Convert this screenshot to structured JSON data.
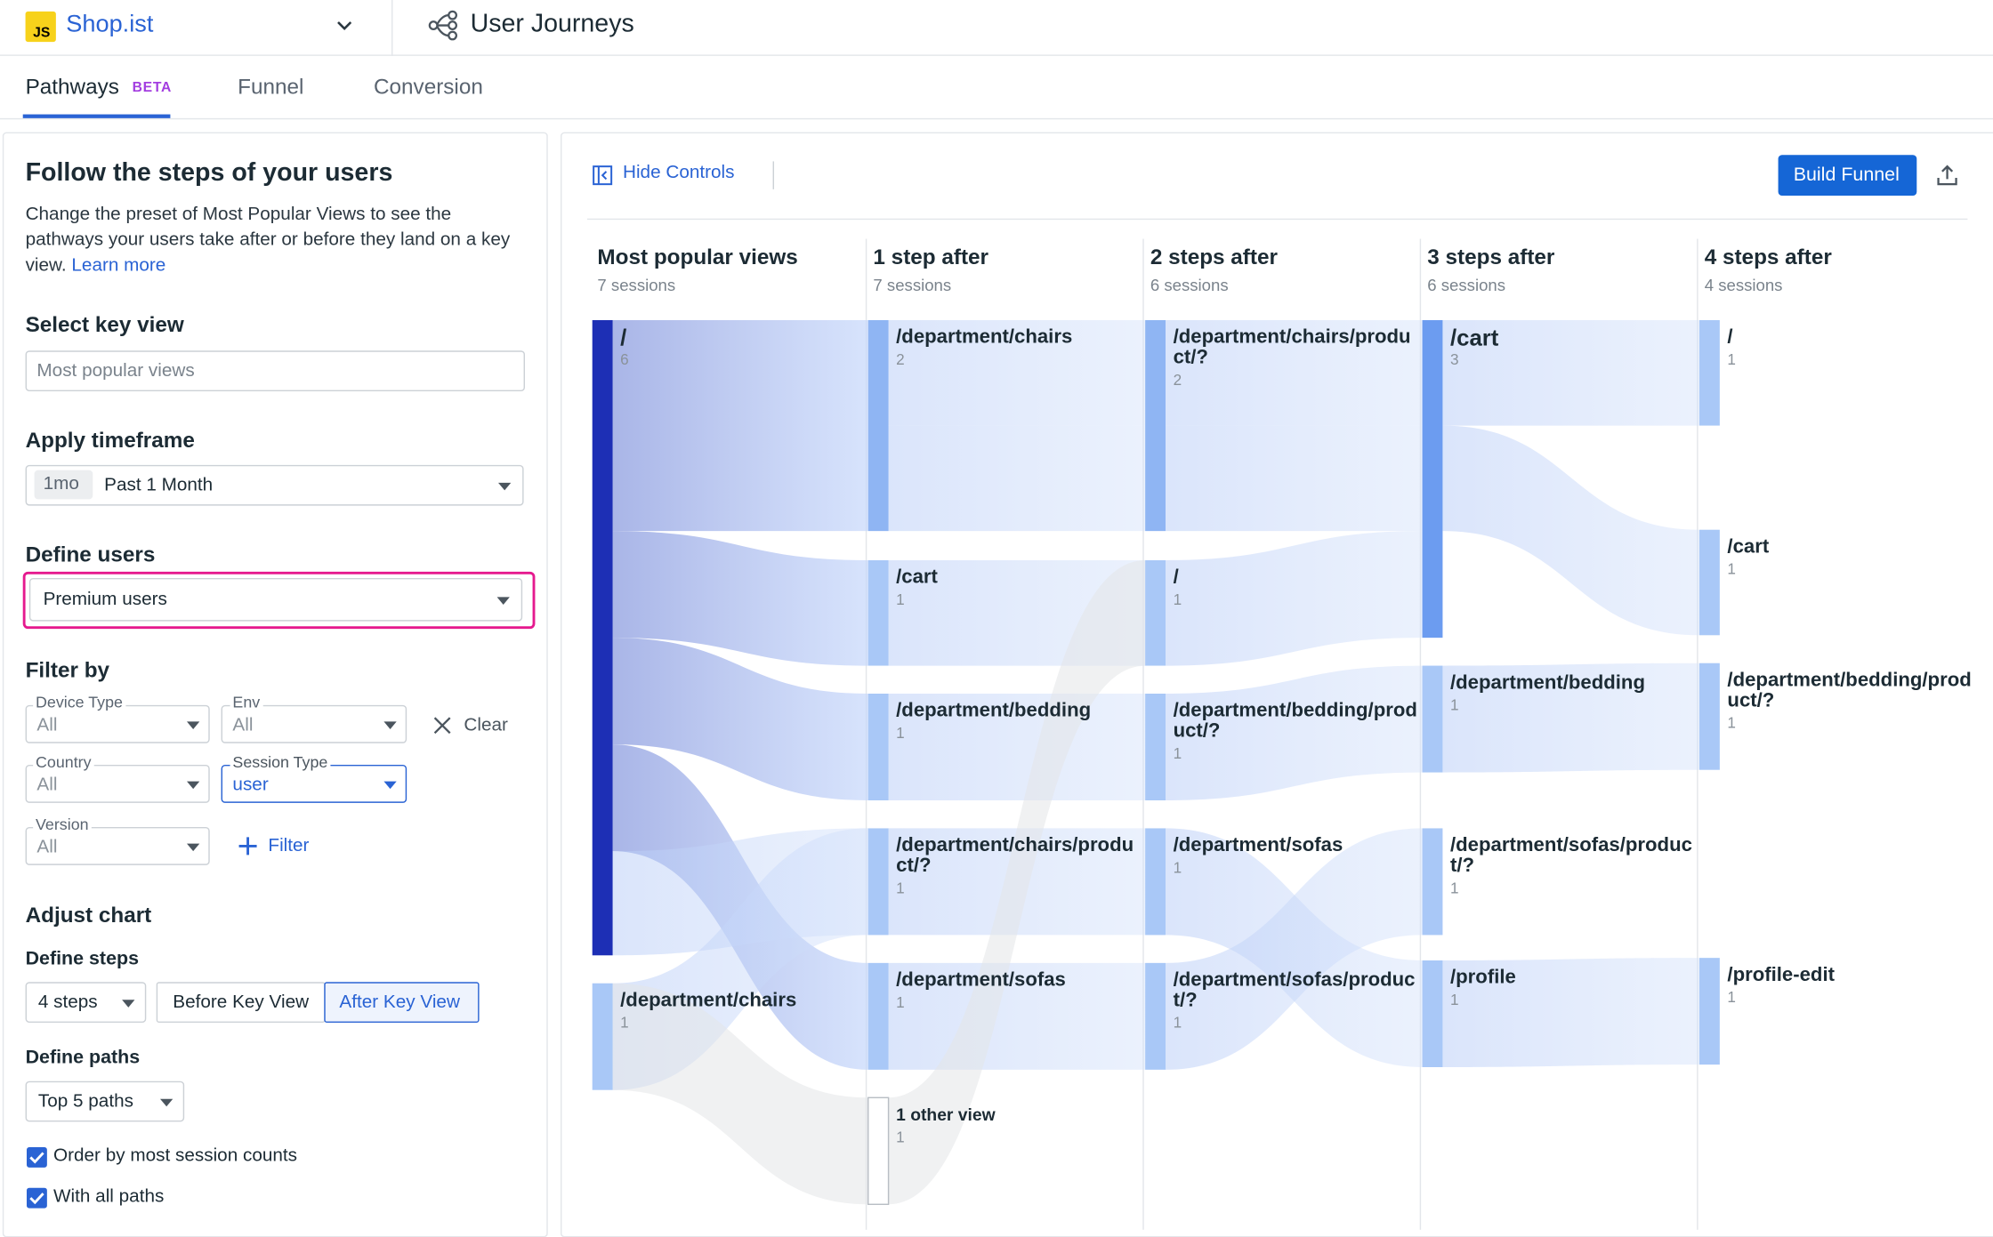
{
  "app": {
    "logo_text": "JS",
    "name": "Shop.ist",
    "page_title": "User Journeys"
  },
  "tabs": [
    {
      "label": "Pathways",
      "badge": "BETA"
    },
    {
      "label": "Funnel"
    },
    {
      "label": "Conversion"
    }
  ],
  "sidebar": {
    "title": "Follow the steps of your users",
    "description": "Change the preset of Most Popular Views to see the pathways your users take after or before they land on a key view.",
    "learn_more": "Learn more",
    "key_view": {
      "label": "Select key view",
      "placeholder": "Most popular views"
    },
    "timeframe": {
      "label": "Apply timeframe",
      "chip": "1mo",
      "value": "Past 1 Month"
    },
    "users": {
      "label": "Define users",
      "value": "Premium users"
    },
    "filter": {
      "label": "Filter by",
      "device_type": {
        "label": "Device Type",
        "value": "All"
      },
      "env": {
        "label": "Env",
        "value": "All"
      },
      "country": {
        "label": "Country",
        "value": "All"
      },
      "session_type": {
        "label": "Session Type",
        "value": "user"
      },
      "version": {
        "label": "Version",
        "value": "All"
      },
      "clear": "Clear",
      "add_filter": "Filter"
    },
    "adjust": {
      "label": "Adjust chart",
      "steps_label": "Define steps",
      "steps_value": "4 steps",
      "before": "Before Key View",
      "after": "After Key View",
      "paths_label": "Define paths",
      "paths_value": "Top 5 paths",
      "order_label": "Order by most session counts",
      "with_all_label": "With all paths"
    }
  },
  "toolbar": {
    "hide_controls": "Hide Controls",
    "build_funnel": "Build Funnel"
  },
  "colors": {
    "accent": "#2a63d4",
    "highlight": "#e5198e",
    "dark_node": "#1d2fb5",
    "node": "#a9c8f7"
  },
  "sankey": {
    "columns": [
      {
        "title": "Most popular views",
        "sessions": "7 sessions"
      },
      {
        "title": "1 step after",
        "sessions": "7 sessions"
      },
      {
        "title": "2 steps after",
        "sessions": "6 sessions"
      },
      {
        "title": "3 steps after",
        "sessions": "6 sessions"
      },
      {
        "title": "4 steps after",
        "sessions": "4 sessions"
      }
    ],
    "nodes": [
      [
        {
          "label": "/",
          "count": "6"
        },
        {
          "label": "/department/chairs",
          "count": "1"
        }
      ],
      [
        {
          "label": "/department/chairs",
          "count": "2"
        },
        {
          "label": "/cart",
          "count": "1"
        },
        {
          "label": "/department/bedding",
          "count": "1"
        },
        {
          "label": "/department/chairs/product/?",
          "count": "1"
        },
        {
          "label": "/department/sofas",
          "count": "1"
        },
        {
          "label": "1 other view",
          "count": "1"
        }
      ],
      [
        {
          "label": "/department/chairs/product/?",
          "count": "2"
        },
        {
          "label": "/",
          "count": "1"
        },
        {
          "label": "/department/bedding/product/?",
          "count": "1"
        },
        {
          "label": "/department/sofas",
          "count": "1"
        },
        {
          "label": "/department/sofas/product/?",
          "count": "1"
        }
      ],
      [
        {
          "label": "/cart",
          "count": "3"
        },
        {
          "label": "/department/bedding",
          "count": "1"
        },
        {
          "label": "/department/sofas/product/?",
          "count": "1"
        },
        {
          "label": "/profile",
          "count": "1"
        }
      ],
      [
        {
          "label": "/",
          "count": "1"
        },
        {
          "label": "/cart",
          "count": "1"
        },
        {
          "label": "/department/bedding/product/?",
          "count": "1"
        },
        {
          "label": "/profile-edit",
          "count": "1"
        }
      ]
    ]
  }
}
